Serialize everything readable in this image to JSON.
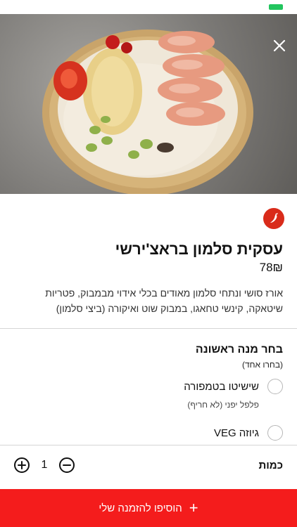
{
  "item": {
    "title": "עסקית סלמון בראצ'ירשי",
    "price": "78₪",
    "description": "אורז סושי ונתחי סלמון מאודים בכלי אידוי מבמבוק, פטריות שיטאקה, קינשי טחאגו, במבוק שוט ואיקורה (ביצי סלמון)"
  },
  "choices": {
    "title": "בחר מנה ראשונה",
    "subtitle": "(בחרו אחד)",
    "options": [
      {
        "label": "שישיטו בטמפורה",
        "sublabel": "פלפל יפני (לא חריף)"
      },
      {
        "label": "גיוזה VEG",
        "sublabel": ""
      }
    ]
  },
  "quantity": {
    "label": "כמות",
    "value": "1"
  },
  "cta": {
    "label": "הוסיפו להזמנה שלי",
    "plus": "+"
  },
  "icons": {
    "close": "close-icon",
    "spicy": "chili-pepper-icon",
    "battery": "battery-icon"
  },
  "colors": {
    "accent": "#f41c1c",
    "spicy_badge": "#d92b1a",
    "battery": "#22c55e"
  }
}
